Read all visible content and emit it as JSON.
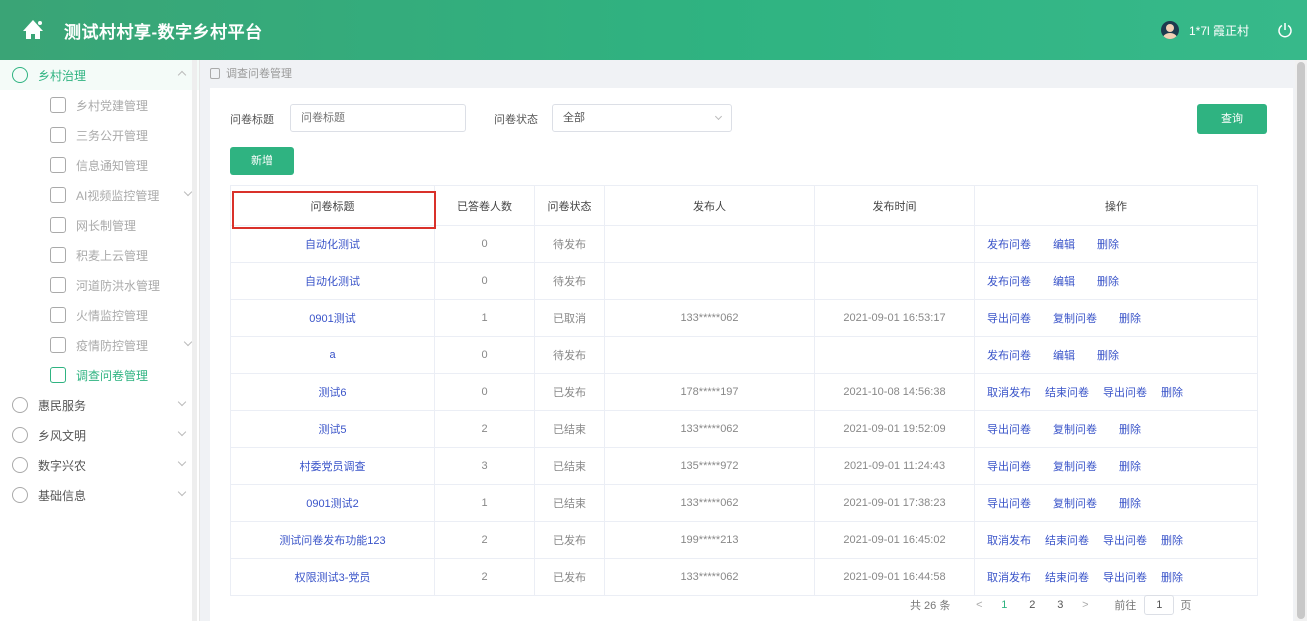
{
  "header": {
    "title": "测试村村享-数字乡村平台",
    "username": "1*7l 霞正村",
    "logo_icon": "village-logo-icon",
    "power_icon": "power-icon"
  },
  "sidebar": {
    "groups": [
      {
        "label": "乡村治理",
        "icon": "governance-icon",
        "expanded": true,
        "items": [
          {
            "label": "乡村党建管理",
            "icon": "party-icon"
          },
          {
            "label": "三务公开管理",
            "icon": "document-icon"
          },
          {
            "label": "信息通知管理",
            "icon": "notice-icon"
          },
          {
            "label": "AI视频监控管理",
            "icon": "camera-icon",
            "has_children": true
          },
          {
            "label": "网长制管理",
            "icon": "grid-icon"
          },
          {
            "label": "积麦上云管理",
            "icon": "cloud-icon"
          },
          {
            "label": "河道防洪水管理",
            "icon": "water-icon"
          },
          {
            "label": "火情监控管理",
            "icon": "fire-icon"
          },
          {
            "label": "疫情防控管理",
            "icon": "virus-icon",
            "has_children": true
          },
          {
            "label": "调查问卷管理",
            "icon": "survey-icon",
            "active": true
          }
        ]
      },
      {
        "label": "惠民服务",
        "icon": "service-icon"
      },
      {
        "label": "乡风文明",
        "icon": "culture-icon"
      },
      {
        "label": "数字兴农",
        "icon": "agriculture-icon"
      },
      {
        "label": "基础信息",
        "icon": "info-icon"
      }
    ]
  },
  "breadcrumb": "调查问卷管理",
  "filters": {
    "title_label": "问卷标题",
    "title_placeholder": "问卷标题",
    "status_label": "问卷状态",
    "status_value": "全部",
    "query_label": "查询",
    "add_label": "新增"
  },
  "table": {
    "headers": [
      "问卷标题",
      "已答卷人数",
      "问卷状态",
      "发布人",
      "发布时间",
      "操作"
    ],
    "rows": [
      {
        "title": "自动化测试",
        "count": "0",
        "status": "待发布",
        "publisher": "",
        "time": "",
        "ops": [
          "发布问卷",
          "编辑",
          "删除"
        ]
      },
      {
        "title": "自动化测试",
        "count": "0",
        "status": "待发布",
        "publisher": "",
        "time": "",
        "ops": [
          "发布问卷",
          "编辑",
          "删除"
        ]
      },
      {
        "title": "0901测试",
        "count": "1",
        "status": "已取消",
        "publisher": "133*****062",
        "time": "2021-09-01 16:53:17",
        "ops": [
          "导出问卷",
          "复制问卷",
          "删除"
        ]
      },
      {
        "title": "a",
        "count": "0",
        "status": "待发布",
        "publisher": "",
        "time": "",
        "ops": [
          "发布问卷",
          "编辑",
          "删除"
        ]
      },
      {
        "title": "测试6",
        "count": "0",
        "status": "已发布",
        "publisher": "178*****197",
        "time": "2021-10-08 14:56:38",
        "ops": [
          "取消发布",
          "结束问卷",
          "导出问卷",
          "删除"
        ]
      },
      {
        "title": "测试5",
        "count": "2",
        "status": "已结束",
        "publisher": "133*****062",
        "time": "2021-09-01 19:52:09",
        "ops": [
          "导出问卷",
          "复制问卷",
          "删除"
        ]
      },
      {
        "title": "村委党员调查",
        "count": "3",
        "status": "已结束",
        "publisher": "135*****972",
        "time": "2021-09-01 11:24:43",
        "ops": [
          "导出问卷",
          "复制问卷",
          "删除"
        ]
      },
      {
        "title": "0901测试2",
        "count": "1",
        "status": "已结束",
        "publisher": "133*****062",
        "time": "2021-09-01 17:38:23",
        "ops": [
          "导出问卷",
          "复制问卷",
          "删除"
        ]
      },
      {
        "title": "测试问卷发布功能123",
        "count": "2",
        "status": "已发布",
        "publisher": "199*****213",
        "time": "2021-09-01 16:45:02",
        "ops": [
          "取消发布",
          "结束问卷",
          "导出问卷",
          "删除"
        ]
      },
      {
        "title": "权限测试3-党员",
        "count": "2",
        "status": "已发布",
        "publisher": "133*****062",
        "time": "2021-09-01 16:44:58",
        "ops": [
          "取消发布",
          "结束问卷",
          "导出问卷",
          "删除"
        ]
      }
    ]
  },
  "pagination": {
    "total": "共 26 条",
    "pages": [
      "1",
      "2",
      "3"
    ],
    "current": "1",
    "prev": "<",
    "next": ">",
    "goto_label": "前往",
    "goto_value": "1",
    "page_suffix": "页"
  },
  "colors": {
    "brand": "#2fb381",
    "link": "#3a54c9",
    "highlight": "#d9312a"
  }
}
